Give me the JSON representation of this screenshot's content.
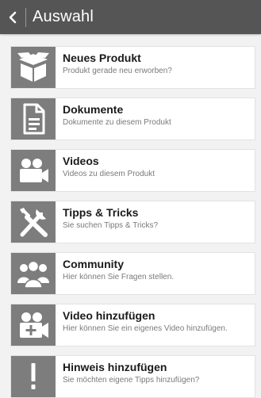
{
  "header": {
    "back_icon": "chevron-left-icon",
    "title": "Auswahl"
  },
  "items": [
    {
      "title": "Neues Produkt",
      "subtitle": "Produkt gerade neu erworben?",
      "icon": "box-icon"
    },
    {
      "title": "Dokumente",
      "subtitle": "Dokumente zu diesem Produkt",
      "icon": "document-icon"
    },
    {
      "title": "Videos",
      "subtitle": "Videos zu diesem Produkt",
      "icon": "video-camera-icon"
    },
    {
      "title": "Tipps & Tricks",
      "subtitle": "Sie suchen Tipps & Tricks?",
      "icon": "tools-icon"
    },
    {
      "title": "Community",
      "subtitle": "Hier können Sie Fragen stellen.",
      "icon": "community-icon"
    },
    {
      "title": "Video hinzufügen",
      "subtitle": "Hier können Sie ein eigenes Video hinzufügen.",
      "icon": "add-video-icon"
    },
    {
      "title": "Hinweis hinzufügen",
      "subtitle": "Sie möchten eigene Tipps hinzufügen?",
      "icon": "exclamation-icon"
    }
  ],
  "colors": {
    "header_bg": "#555555",
    "icon_bg": "#7d7d7d",
    "page_bg": "#f2f2f2"
  }
}
